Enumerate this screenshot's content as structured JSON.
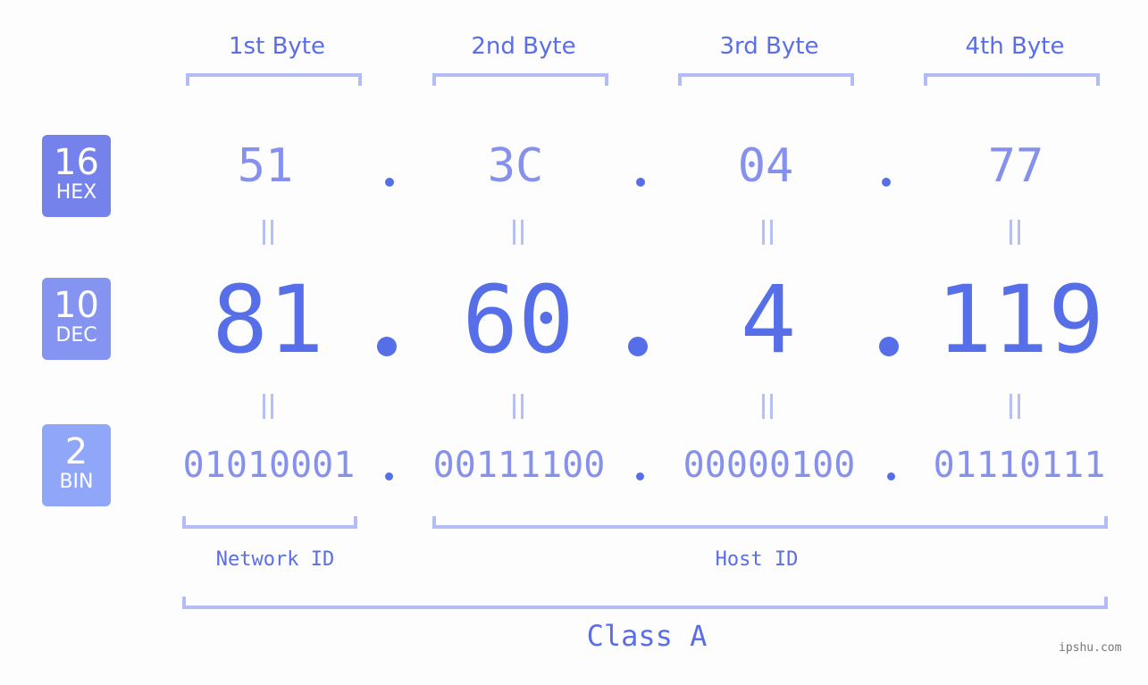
{
  "colors": {
    "hex_badge": "#7582ec",
    "dec_badge": "#8593f1",
    "bin_badge": "#8fa6f9",
    "accent": "#566fe9",
    "secondary": "#8591ec",
    "bracket": "#b3bcf7"
  },
  "bytes": [
    {
      "label": "1st Byte",
      "hex": "51",
      "dec": "81",
      "bin": "01010001"
    },
    {
      "label": "2nd Byte",
      "hex": "3C",
      "dec": "60",
      "bin": "00111100"
    },
    {
      "label": "3rd Byte",
      "hex": "04",
      "dec": "4",
      "bin": "00000100"
    },
    {
      "label": "4th Byte",
      "hex": "77",
      "dec": "119",
      "bin": "01110111"
    }
  ],
  "bases": {
    "hex": {
      "number": "16",
      "name": "HEX"
    },
    "dec": {
      "number": "10",
      "name": "DEC"
    },
    "bin": {
      "number": "2",
      "name": "BIN"
    }
  },
  "segments": {
    "network_id": "Network ID",
    "host_id": "Host ID",
    "class": "Class A"
  },
  "watermark": "ipshu.com"
}
